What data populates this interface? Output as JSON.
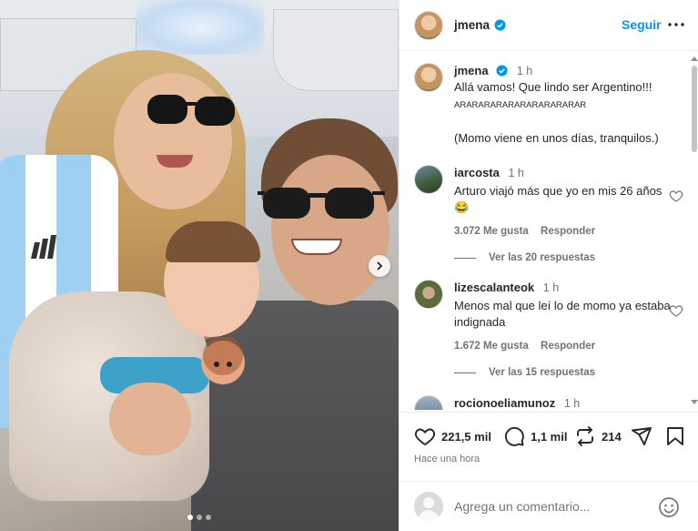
{
  "post": {
    "username": "jmena",
    "follow_label": "Seguir",
    "caption_time": "1 h",
    "caption_line1": "Allá vamos! Que lindo ser Argentino!!!",
    "caption_line2": "ARARARARARARARARARARAR",
    "caption_line3": "(Momo viene en unos días, tranquilos.)",
    "likes": "221,5 mil",
    "comments_count": "1,1 mil",
    "reposts": "214",
    "posted_ago": "Hace una hora",
    "comment_placeholder": "Agrega un comentario..."
  },
  "comments": [
    {
      "user": "iarcosta",
      "time": "1 h",
      "text": "Arturo viajó más que yo en mis 26 años 😂",
      "likes": "3.072 Me gusta",
      "reply_label": "Responder",
      "replies": "Ver las 20 respuestas"
    },
    {
      "user": "lizescalanteok",
      "time": "1 h",
      "text": "Menos mal que leí lo de momo ya estaba indignada",
      "likes": "1.672 Me gusta",
      "reply_label": "Responder",
      "replies": "Ver las 15 respuestas"
    },
    {
      "user": "rocionoeliamunoz",
      "time": "1 h"
    }
  ],
  "carousel": {
    "total": 3,
    "current": 1
  },
  "colors": {
    "link": "#0095f6",
    "verified": "#0095f6",
    "muted": "#737373"
  }
}
